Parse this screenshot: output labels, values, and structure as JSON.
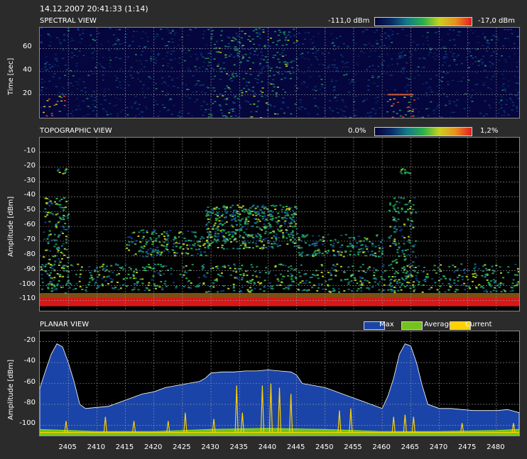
{
  "header": {
    "timestamp": "14.12.2007 20:41:33 (1:14)"
  },
  "spectral": {
    "title": "SPECTRAL VIEW",
    "ylabel": "Time [sec]",
    "yticks": [
      "60",
      "40",
      "20"
    ],
    "colorbar_min": "-111,0 dBm",
    "colorbar_max": "-17,0 dBm"
  },
  "topographic": {
    "title": "TOPOGRAPHIC VIEW",
    "ylabel": "Amplitude [dBm]",
    "yticks": [
      "-10",
      "-20",
      "-30",
      "-40",
      "-50",
      "-60",
      "-70",
      "-80",
      "-90",
      "-100",
      "-110"
    ],
    "colorbar_min": "0.0%",
    "colorbar_max": "1,2%"
  },
  "planar": {
    "title": "PLANAR VIEW",
    "ylabel": "Amplitude [dBm]",
    "yticks": [
      "-20",
      "-40",
      "-60",
      "-80",
      "-100"
    ],
    "legend": [
      {
        "label": "Max",
        "color": "#1a44a8"
      },
      {
        "label": "Average",
        "color": "#74c21a"
      },
      {
        "label": "Current",
        "color": "#ffd200"
      }
    ]
  },
  "xaxis": {
    "ticks": [
      "2405",
      "2410",
      "2415",
      "2420",
      "2425",
      "2430",
      "2435",
      "2440",
      "2445",
      "2450",
      "2455",
      "2460",
      "2465",
      "2470",
      "2475",
      "2480"
    ]
  },
  "chart_data": [
    {
      "type": "heatmap",
      "title": "SPECTRAL VIEW",
      "ylabel": "Time [sec]",
      "xlim": [
        2400,
        2484
      ],
      "ylim": [
        0,
        78
      ],
      "colorbar": {
        "min": -111,
        "max": -17,
        "unit": "dBm"
      },
      "grid": true
    },
    {
      "type": "heatmap",
      "title": "TOPOGRAPHIC VIEW",
      "ylabel": "Amplitude [dBm]",
      "xlim": [
        2400,
        2484
      ],
      "ylim": [
        -117,
        0
      ],
      "colorbar": {
        "min": 0.0,
        "max": 1.2,
        "unit": "%"
      },
      "grid": true
    },
    {
      "type": "area",
      "title": "PLANAR VIEW",
      "ylabel": "Amplitude [dBm]",
      "xlim": [
        2400,
        2484
      ],
      "ylim": [
        -110,
        -10
      ],
      "grid": true,
      "legend_position": "top-right",
      "series": [
        {
          "name": "Max",
          "x": [
            2400,
            2401,
            2402,
            2403,
            2404,
            2405,
            2406,
            2407,
            2408,
            2410,
            2412,
            2414,
            2416,
            2418,
            2420,
            2422,
            2424,
            2426,
            2428,
            2429,
            2430,
            2432,
            2434,
            2436,
            2438,
            2440,
            2442,
            2444,
            2445,
            2446,
            2448,
            2450,
            2452,
            2454,
            2456,
            2458,
            2460,
            2461,
            2462,
            2463,
            2464,
            2465,
            2466,
            2467,
            2468,
            2470,
            2472,
            2474,
            2476,
            2478,
            2480,
            2482,
            2484
          ],
          "values": [
            -65,
            -48,
            -32,
            -22,
            -25,
            -40,
            -58,
            -80,
            -84,
            -83,
            -82,
            -78,
            -74,
            -70,
            -68,
            -64,
            -62,
            -60,
            -58,
            -55,
            -50,
            -49,
            -49,
            -48,
            -48,
            -47,
            -48,
            -49,
            -52,
            -60,
            -62,
            -64,
            -68,
            -72,
            -76,
            -80,
            -84,
            -72,
            -55,
            -32,
            -22,
            -24,
            -40,
            -62,
            -80,
            -84,
            -84,
            -85,
            -86,
            -86,
            -86,
            -85,
            -88
          ]
        },
        {
          "name": "Average",
          "x": [
            2400,
            2410,
            2420,
            2430,
            2440,
            2450,
            2460,
            2470,
            2480,
            2484
          ],
          "values": [
            -104,
            -106,
            -106,
            -104,
            -103,
            -104,
            -106,
            -106,
            -105,
            -104
          ]
        },
        {
          "name": "Current",
          "x": [
            2400,
            2404.6,
            2407,
            2411.5,
            2416.5,
            2422.5,
            2425.5,
            2430.5,
            2434.5,
            2435.5,
            2439,
            2440.5,
            2442,
            2444,
            2452.5,
            2454.5,
            2462,
            2464,
            2465.5,
            2474,
            2483
          ],
          "values": [
            -108,
            -96,
            -108,
            -92,
            -96,
            -96,
            -88,
            -94,
            -62,
            -88,
            -62,
            -60,
            -64,
            -70,
            -86,
            -84,
            -92,
            -90,
            -92,
            -98,
            -98
          ]
        }
      ]
    }
  ]
}
